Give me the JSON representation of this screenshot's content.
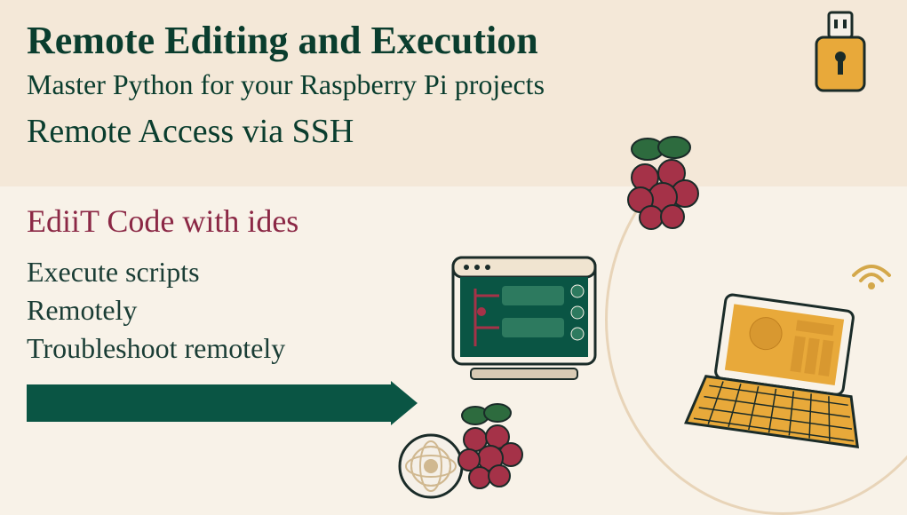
{
  "header": {
    "title": "Remote Editing and Execution",
    "subtitle": "Master Python for your Raspberry Pi projects",
    "ssh": "Remote Access via SSH"
  },
  "main": {
    "edit": "EdiiT Code with ides",
    "items": [
      "Execute scripts",
      "Remotely",
      "Troubleshoot remotely"
    ]
  },
  "icons": {
    "usb_lock": "usb-lock-icon",
    "raspberry": "raspberry-icon",
    "monitor": "monitor-icon",
    "laptop": "laptop-icon",
    "fruit": "fruit-icon",
    "wifi": "wifi-icon"
  }
}
